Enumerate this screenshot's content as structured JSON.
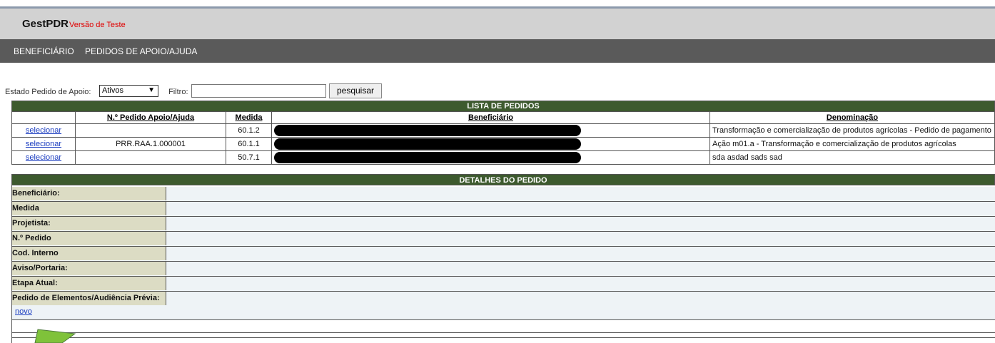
{
  "header": {
    "app_name": "GestPDR",
    "app_subtitle": "Versão de Teste"
  },
  "nav": {
    "items": [
      "BENEFICIÁRIO",
      "PEDIDOS DE APOIO/AJUDA"
    ]
  },
  "filter": {
    "estado_label": "Estado Pedido de Apoio:",
    "estado_value": "Ativos",
    "filtro_label": "Filtro:",
    "filtro_value": "",
    "search_label": "pesquisar"
  },
  "list": {
    "title": "LISTA DE PEDIDOS",
    "columns": [
      "N.º Pedido Apoio/Ajuda",
      "Medida",
      "Beneficiário",
      "Denominação"
    ],
    "rows": [
      {
        "action": "selecionar",
        "numero": "",
        "medida": "60.1.2",
        "beneficiario": "",
        "denominacao": "Transformação e comercialização de produtos agrícolas - Pedido de pagamento"
      },
      {
        "action": "selecionar",
        "numero": "PRR.RAA.1.000001",
        "medida": "60.1.1",
        "beneficiario": "",
        "denominacao": "Ação m01.a - Transformação e comercialização de produtos agrícolas"
      },
      {
        "action": "selecionar",
        "numero": "",
        "medida": "50.7.1",
        "beneficiario": "",
        "denominacao": "sda asdad sads sad"
      }
    ]
  },
  "details": {
    "title": "DETALHES DO PEDIDO",
    "fields": [
      "Beneficiário:",
      "Medida",
      "Projetista:",
      "N.º Pedido",
      "Cod. Interno",
      "Aviso/Portaria:",
      "Etapa Atual:",
      "Pedido de Elementos/Audiência Prévia:"
    ],
    "new_link": "novo"
  },
  "colors": {
    "band": "#3d5a2e",
    "navbar": "#5a5a5a",
    "header": "#d2d2d2",
    "link": "#1a3cc0",
    "subtitle": "#e00000"
  }
}
